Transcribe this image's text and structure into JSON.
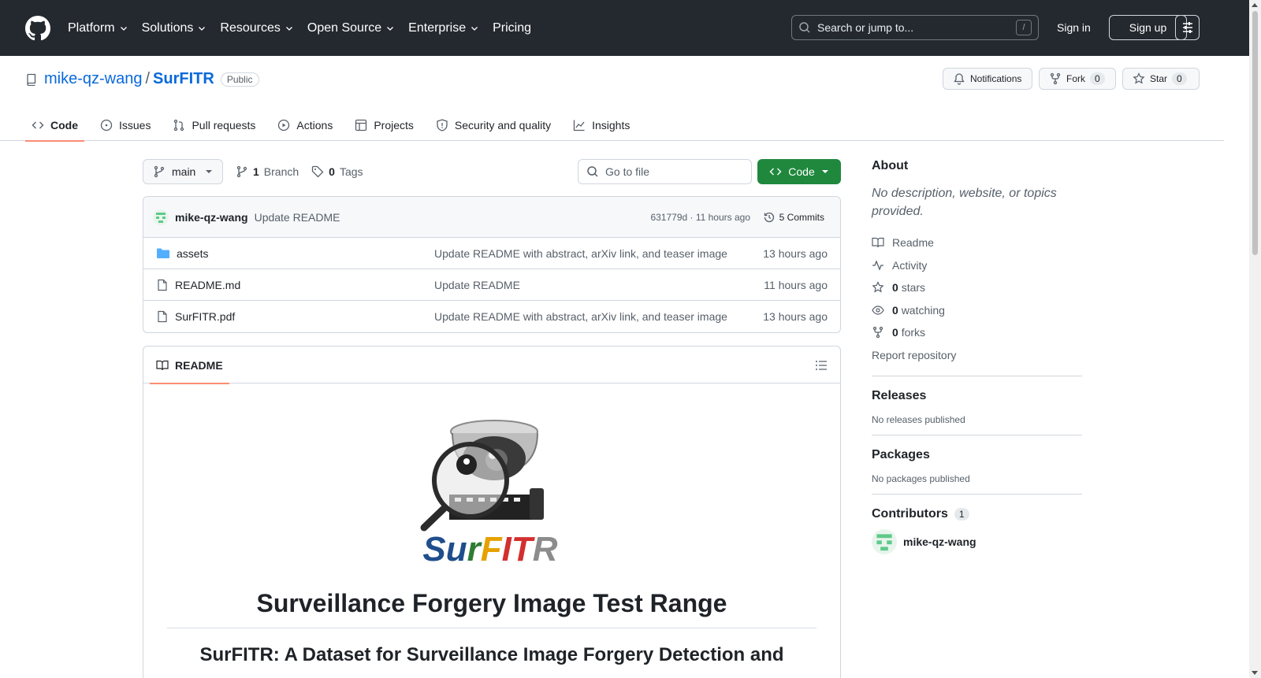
{
  "header": {
    "nav": [
      "Platform",
      "Solutions",
      "Resources",
      "Open Source",
      "Enterprise",
      "Pricing"
    ],
    "search_placeholder": "Search or jump to...",
    "search_shortcut": "/",
    "sign_in": "Sign in",
    "sign_up": "Sign up"
  },
  "repo": {
    "owner": "mike-qz-wang",
    "separator": "/",
    "name": "SurFITR",
    "visibility": "Public",
    "notifications": "Notifications",
    "fork": "Fork",
    "fork_count": "0",
    "star": "Star",
    "star_count": "0",
    "tabs": [
      "Code",
      "Issues",
      "Pull requests",
      "Actions",
      "Projects",
      "Security and quality",
      "Insights"
    ]
  },
  "toolbar": {
    "branch": "main",
    "branch_count": "1",
    "branch_label": "Branch",
    "tag_count": "0",
    "tag_label": "Tags",
    "goto_placeholder": "Go to file",
    "code_button": "Code"
  },
  "commit": {
    "author": "mike-qz-wang",
    "message": "Update README",
    "meta": "631779d · 11 hours ago",
    "commits": "5 Commits"
  },
  "files": [
    {
      "name": "assets",
      "type": "folder",
      "message": "Update README with abstract, arXiv link, and teaser image",
      "age": "13 hours ago"
    },
    {
      "name": "README.md",
      "type": "file",
      "message": "Update README",
      "age": "11 hours ago"
    },
    {
      "name": "SurFITR.pdf",
      "type": "file",
      "message": "Update README with abstract, arXiv link, and teaser image",
      "age": "13 hours ago"
    }
  ],
  "readme": {
    "tab": "README",
    "logo_text": "SurFITR",
    "h1": "Surveillance Forgery Image Test Range",
    "h2": "SurFITR: A Dataset for Surveillance Image Forgery Detection and"
  },
  "sidebar": {
    "about_title": "About",
    "about_desc": "No description, website, or topics provided.",
    "readme": "Readme",
    "activity": "Activity",
    "stars_count": "0",
    "stars_label": "stars",
    "watching_count": "0",
    "watching_label": "watching",
    "forks_count": "0",
    "forks_label": "forks",
    "report": "Report repository",
    "releases_title": "Releases",
    "releases_note": "No releases published",
    "packages_title": "Packages",
    "packages_note": "No packages published",
    "contributors_title": "Contributors",
    "contributors_count": "1",
    "contributor": "mike-qz-wang"
  },
  "colors": {
    "header_bg": "#24292f",
    "link": "#0969da",
    "primary_button": "#1f883d",
    "active_tab_underline": "#fd8c73"
  }
}
